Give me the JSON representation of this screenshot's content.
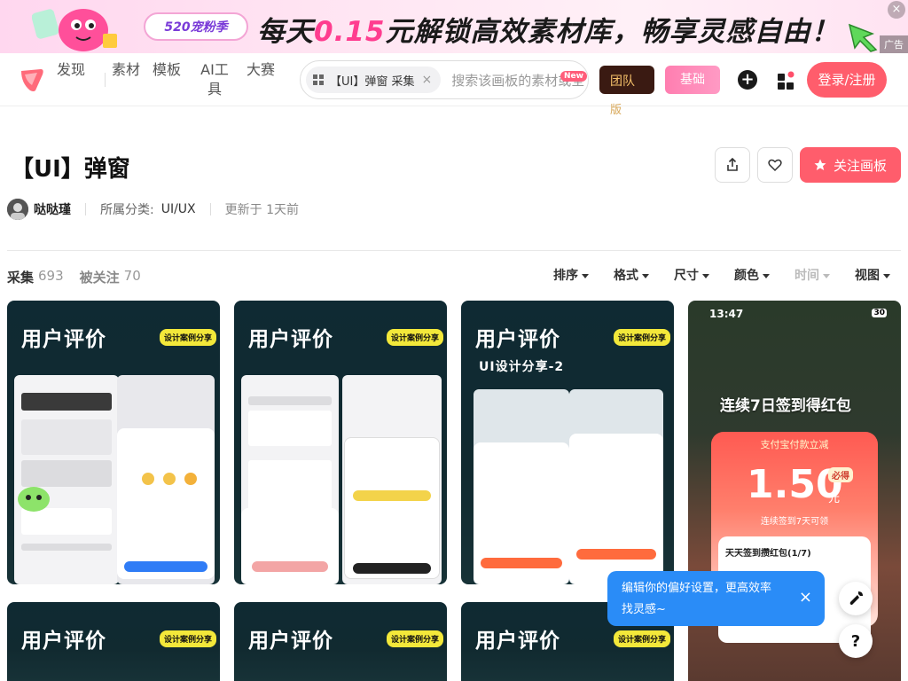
{
  "ad": {
    "badge": "520宠粉季",
    "text_prefix": "每天",
    "text_highlight": "0.15",
    "text_suffix": "元解锁高效素材库，畅享灵感自由！",
    "label": "广告",
    "close": "×"
  },
  "nav": {
    "items": [
      "发现",
      "素材",
      "模板",
      "AI工具",
      "大赛"
    ],
    "search": {
      "chip_label": "【UI】弹窗 采集",
      "chip_close": "×",
      "placeholder": "搜索该画板的素材或全"
    },
    "new_badge": "New",
    "team_btn": "团队",
    "team_sub": "版",
    "basic_btn": "基础",
    "plus": "+",
    "login": "登录/注册"
  },
  "board": {
    "title": "【UI】弹窗",
    "follow": "关注画板",
    "author": "哒哒瑾",
    "category_label": "所属分类:",
    "category_value": "UI/UX",
    "updated": "更新于 1天前"
  },
  "stats": {
    "collect_label": "采集",
    "collect_count": "693",
    "followers_label": "被关注",
    "followers_count": "70"
  },
  "filters": [
    "排序",
    "格式",
    "尺寸",
    "颜色",
    "时间",
    "视图"
  ],
  "cards": [
    {
      "title": "用户评价",
      "tag": "设计案例分享",
      "subtitle": ""
    },
    {
      "title": "用户评价",
      "tag": "设计案例分享",
      "subtitle": ""
    },
    {
      "title": "用户评价",
      "tag": "设计案例分享",
      "subtitle": "UI设计分享-2"
    },
    {
      "title": "用户评价",
      "tag": "设计案例分享"
    },
    {
      "title": "用户评价",
      "tag": "设计案例分享"
    },
    {
      "title": "用户评价",
      "tag": "设计案例分享"
    }
  ],
  "card4": {
    "time": "13:47",
    "battery": "30",
    "headline": "连续7日签到得红包",
    "panel_label": "支付宝付款立减",
    "amount": "1.50",
    "unit": "元",
    "must": "必得",
    "sub": "连续签到7天可领",
    "progress": "天天签到攒红包(1/7)"
  },
  "toast": {
    "line1": "编辑你的偏好设置，更高效率",
    "line2": "找灵感~",
    "close": "×"
  },
  "help": "?",
  "colors": {
    "brand": "#ff5d6c",
    "toast": "#2a8cf7",
    "card_bg": "#0f2a33",
    "tag": "#f3e83a"
  }
}
